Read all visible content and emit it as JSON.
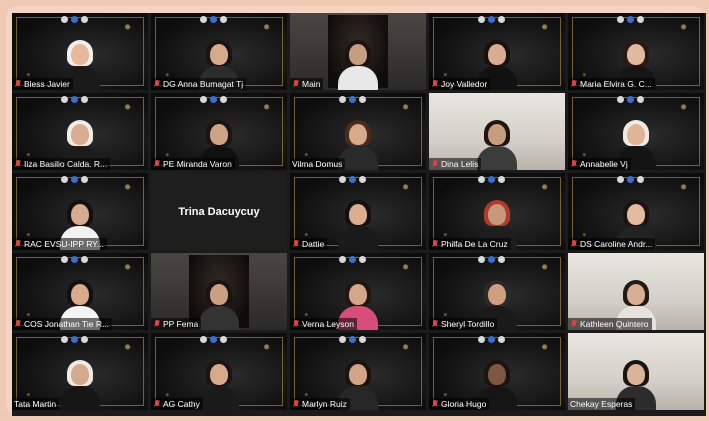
{
  "participants": [
    {
      "name": "Bless Javier",
      "style": "poster",
      "muted": true,
      "active": true,
      "skin": "#e6b99c",
      "hair": "#f2f0ee",
      "shirt": "#1a1a1a"
    },
    {
      "name": "DG Anna Bumagat Tj",
      "style": "poster",
      "muted": true,
      "skin": "#d7aa8c",
      "hair": "#1a1310",
      "shirt": "#2d2d2d"
    },
    {
      "name": "Main",
      "style": "inner",
      "muted": true,
      "skin": "#c79d82",
      "hair": "#1a1310",
      "shirt": "#e8e8e8"
    },
    {
      "name": "Joy Valledor",
      "style": "poster",
      "muted": true,
      "skin": "#d9ab8f",
      "hair": "#17110f",
      "shirt": "#111"
    },
    {
      "name": "Maria Elvira G. C...",
      "style": "poster",
      "muted": true,
      "skin": "#e2b89f",
      "hair": "#2a1a14",
      "shirt": "#151515"
    },
    {
      "name": "Iiza Basilio Calda. R...",
      "style": "poster",
      "muted": true,
      "skin": "#d9ad90",
      "hair": "#f0ece7",
      "shirt": "#1c1c1c"
    },
    {
      "name": "PE Miranda Varon",
      "style": "poster",
      "muted": true,
      "skin": "#cfa387",
      "hair": "#1a1310",
      "shirt": "#101010"
    },
    {
      "name": "Vilma Domus",
      "style": "poster",
      "muted": false,
      "skin": "#d8a98a",
      "hair": "#4a2b1c",
      "shirt": "#2a2a2a"
    },
    {
      "name": "Dina Lelis",
      "style": "room",
      "muted": true,
      "skin": "#c89c7f",
      "hair": "#1c1512",
      "shirt": "#3c3c3c"
    },
    {
      "name": "Annabelle Vj",
      "style": "poster",
      "muted": true,
      "skin": "#e0b597",
      "hair": "#efeae5",
      "shirt": "#141414"
    },
    {
      "name": "RAC EVSU-IPP RY...",
      "style": "poster",
      "muted": true,
      "skin": "#d7ab8e",
      "hair": "#111",
      "shirt": "#f2f2f2"
    },
    {
      "name": "Trina Dacuycuy",
      "style": "blank",
      "muted": false
    },
    {
      "name": "Dattie",
      "style": "poster",
      "muted": true,
      "skin": "#dcae90",
      "hair": "#151010",
      "shirt": "#1a1a1a"
    },
    {
      "name": "Philfa De La Cruz",
      "style": "poster",
      "muted": true,
      "skin": "#c8987a",
      "hair": "#b03a2e",
      "shirt": "#1e1e1e"
    },
    {
      "name": "DS Caroline Andr...",
      "style": "poster",
      "muted": true,
      "skin": "#e4bba0",
      "hair": "#1a1310",
      "shirt": "#222"
    },
    {
      "name": "COS Jonathan Tie R...",
      "style": "poster",
      "muted": true,
      "skin": "#d8ab8d",
      "hair": "#111",
      "shirt": "#f4f4f4"
    },
    {
      "name": "PP Fema",
      "style": "inner",
      "muted": true,
      "skin": "#caa084",
      "hair": "#1a1310",
      "shirt": "#333"
    },
    {
      "name": "Verna Leyson",
      "style": "poster",
      "muted": true,
      "skin": "#d5a688",
      "hair": "#23160f",
      "shirt": "#d64c7a"
    },
    {
      "name": "Sheryl Tordillo",
      "style": "poster",
      "muted": true,
      "skin": "#cf9f81",
      "hair": "#2a2a2a",
      "shirt": "#1a1a1a"
    },
    {
      "name": "Kathleen Quintero",
      "style": "room",
      "muted": true,
      "skin": "#d9ad91",
      "hair": "#231915",
      "shirt": "#e7e2dc"
    },
    {
      "name": "Tata Martin",
      "style": "poster",
      "muted": false,
      "skin": "#d5a98c",
      "hair": "#efeae4",
      "shirt": "#151515"
    },
    {
      "name": "AG Cathy",
      "style": "poster",
      "muted": true,
      "skin": "#d8aa8c",
      "hair": "#1b1412",
      "shirt": "#1a1a1a"
    },
    {
      "name": "Marlyn Ruiz",
      "style": "poster",
      "muted": true,
      "skin": "#d3a487",
      "hair": "#1a1310",
      "shirt": "#272727"
    },
    {
      "name": "Gloria Hugo",
      "style": "poster",
      "muted": true,
      "skin": "#7e5743",
      "hair": "#1a1310",
      "shirt": "#151515"
    },
    {
      "name": "Chekay Esperas",
      "style": "room",
      "muted": false,
      "skin": "#dcb298",
      "hair": "#1a1310",
      "shirt": "#2c2c2c"
    }
  ],
  "colors": {
    "frame": "#f4d3c2",
    "active_outline": "#d6e34a",
    "muted_icon": "#e34040",
    "poster_gold": "#d8b46a"
  },
  "icons": {
    "muted": "microphone-muted-icon"
  }
}
